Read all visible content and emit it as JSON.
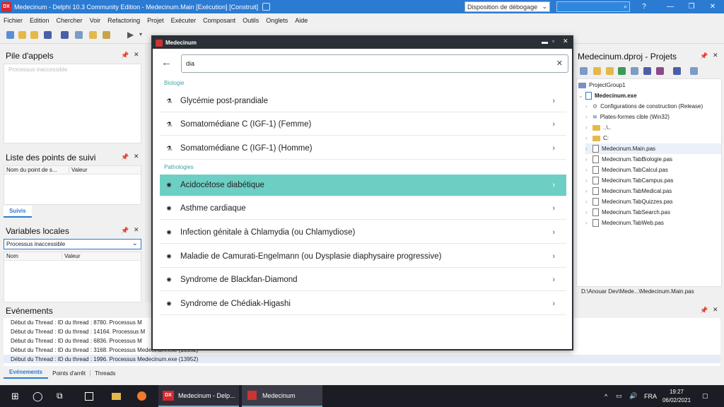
{
  "window": {
    "title": "Medecinum - Delphi 10.3 Community Edition - Medecinum.Main [Exécution] [Construit]",
    "layout": "Disposition de débogage",
    "controls": [
      "?",
      "—",
      "❐",
      "✕"
    ]
  },
  "menu": [
    "Fichier",
    "Edition",
    "Chercher",
    "Voir",
    "Refactoring",
    "Projet",
    "Exécuter",
    "Composant",
    "Outils",
    "Onglets",
    "Aide"
  ],
  "left": {
    "callstack": {
      "title": "Pile d'appels",
      "content": "Processus inaccessible"
    },
    "watch": {
      "title": "Liste des points de suivi",
      "col1": "Nom du point de s...",
      "col2": "Valeur",
      "tab": "Suivis"
    },
    "locals": {
      "title": "Variables locales",
      "select": "Processus inaccessible",
      "col1": "Nom",
      "col2": "Valeur"
    }
  },
  "events": {
    "title": "Evénements",
    "lines": [
      "Début du Thread : ID du thread : 8780. Processus M",
      "Début du Thread : ID du thread : 14164. Processus M",
      "Début du Thread : ID du thread : 6836. Processus M",
      "Début du Thread : ID du thread : 3168. Processus Medecinum.exe (13952)",
      "Début du Thread : ID du thread : 1996. Processus Medecinum.exe (13952)"
    ],
    "tabs": [
      "Evénements",
      "Points d'arrêt",
      "Threads"
    ]
  },
  "project": {
    "title": "Medecinum.dproj - Projets",
    "group": "ProjectGroup1",
    "exe": "Medecinum.exe",
    "items": [
      "Configurations de construction (Release)",
      "Plates-formes cible (Win32)",
      "..\\..",
      "C:",
      "Medecinum.Main.pas",
      "Medecinum.TabBiologie.pas",
      "Medecinum.TabCalcul.pas",
      "Medecinum.TabCampus.pas",
      "Medecinum.TabMedical.pas",
      "Medecinum.TabQuizzes.pas",
      "Medecinum.TabSearch.pas",
      "Medecinum.TabWeb.pas"
    ],
    "path": "D:\\Anouar Dev\\Mede...\\Medecinum.Main.pas"
  },
  "dialog": {
    "title": "Medecinum",
    "query": "dia",
    "sec1": "Biologie",
    "bio": [
      "Glycémie post-prandiale",
      "Somatomédiane C (IGF-1) (Femme)",
      "Somatomédiane C (IGF-1) (Homme)"
    ],
    "sec2": "Pathologies",
    "patho": [
      "Acidocétose diabétique",
      "Asthme cardiaque",
      "Infection génitale à Chlamydia (ou Chlamydiose)",
      "Maladie de Camurati-Engelmann (ou Dysplasie diaphysaire progressive)",
      "Syndrome de Blackfan-Diamond",
      "Syndrome de Chédiak-Higashi"
    ]
  },
  "taskbar": {
    "app1": "Medecinum - Delp...",
    "app2": "Medecinum",
    "lang": "FRA",
    "time": "19:27",
    "date": "06/02/2021"
  },
  "colors": {
    "titlebar": "#2b7bd2",
    "selected": "#6dcfc4",
    "accent": "#3ea6a8"
  }
}
